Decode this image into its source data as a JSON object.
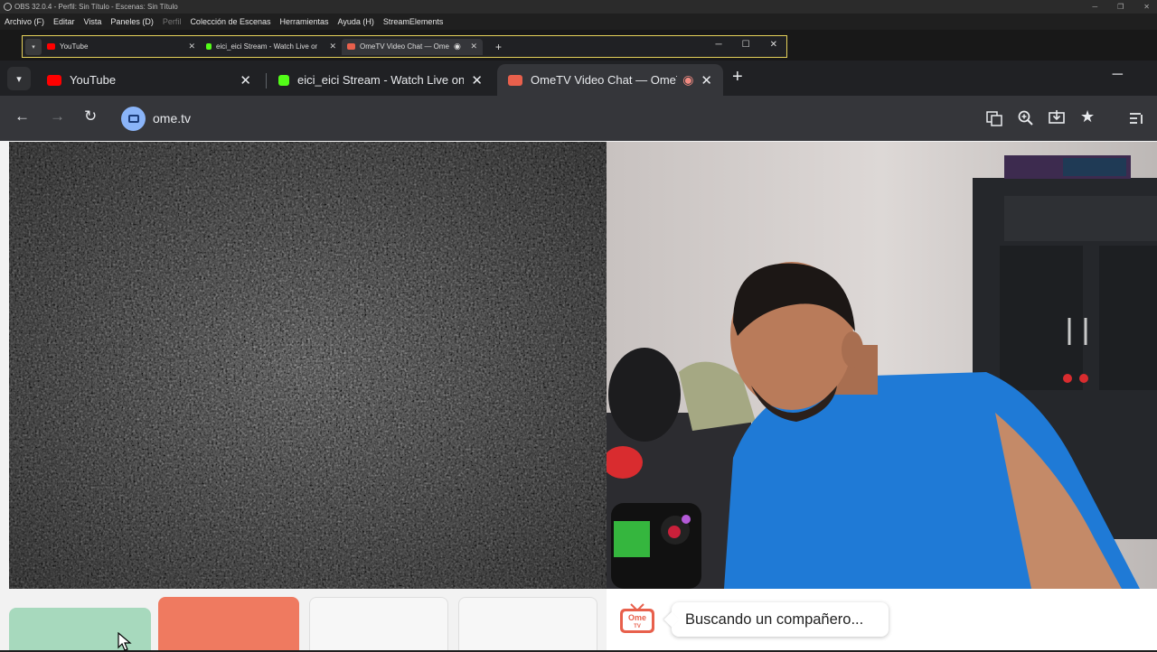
{
  "obs": {
    "title": "OBS 32.0.4 - Perfil: Sin Título - Escenas: Sin Título",
    "menu": [
      "Archivo (F)",
      "Editar",
      "Vista",
      "Paneles (D)",
      "Perfil",
      "Colección de Escenas",
      "Herramientas",
      "Ayuda (H)",
      "StreamElements"
    ]
  },
  "mini_browser": {
    "tabs": [
      {
        "label": "YouTube",
        "favicon_color": "#ff0000"
      },
      {
        "label": "eici_eici Stream - Watch Live on",
        "favicon_color": "#53fc18"
      },
      {
        "label": "OmeTV Video Chat — Ome",
        "favicon_color": "#e8604c"
      }
    ]
  },
  "browser": {
    "tabs": [
      {
        "label": "YouTube",
        "favicon": "youtube-icon",
        "favicon_color": "#ff0000",
        "active": false
      },
      {
        "label": "eici_eici Stream - Watch Live on Kick",
        "favicon": "kick-icon",
        "favicon_color": "#53fc18",
        "active": false
      },
      {
        "label": "OmeTV Video Chat — OmeTV",
        "favicon": "ometv-icon",
        "favicon_color": "#e8604c",
        "active": true
      }
    ],
    "url": "ome.tv"
  },
  "chat": {
    "status": "Buscando un compañero..."
  },
  "colors": {
    "start_button": "#a7d9bd",
    "stop_button": "#ef7a60",
    "accent": "#8ab4f8"
  }
}
